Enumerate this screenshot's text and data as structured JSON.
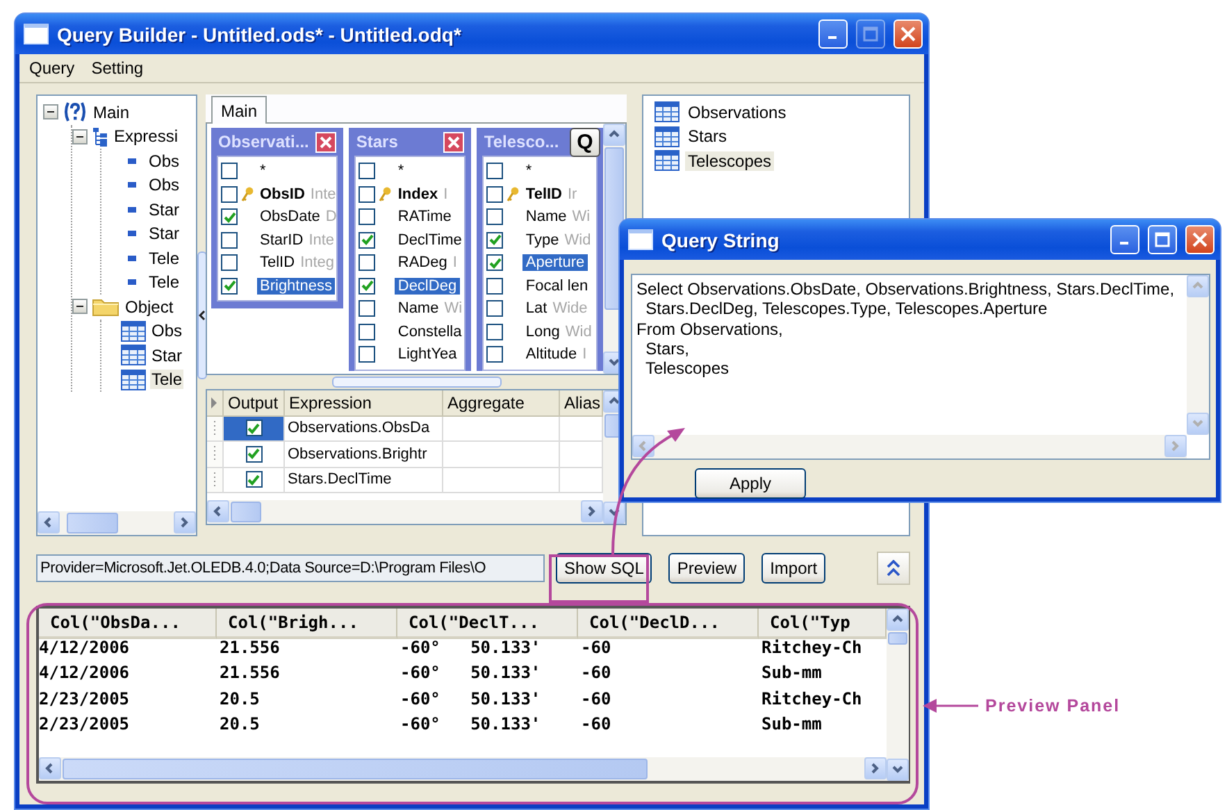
{
  "window": {
    "title": "Query Builder - Untitled.ods* - Untitled.odq*",
    "controls": [
      {
        "kind": "minimize",
        "disabled": false
      },
      {
        "kind": "maximize",
        "disabled": true
      },
      {
        "kind": "close",
        "disabled": false
      }
    ]
  },
  "menu": [
    "Query",
    "Setting"
  ],
  "object_tree": {
    "items": [
      {
        "label": "Main",
        "kind": "query",
        "expanded": true,
        "selected": false,
        "children": [
          {
            "label": "Expressi",
            "kind": "expressions",
            "expanded": true,
            "selected": false,
            "children": [
              {
                "label": "Obs",
                "kind": "field",
                "selected": false
              },
              {
                "label": "Obs",
                "kind": "field",
                "selected": false
              },
              {
                "label": "Star",
                "kind": "field",
                "selected": false
              },
              {
                "label": "Star",
                "kind": "field",
                "selected": false
              },
              {
                "label": "Tele",
                "kind": "field",
                "selected": false
              },
              {
                "label": "Tele",
                "kind": "field",
                "selected": false
              }
            ]
          },
          {
            "label": "Object",
            "kind": "folder",
            "expanded": true,
            "selected": false,
            "children": [
              {
                "label": "Obs",
                "kind": "table",
                "selected": false
              },
              {
                "label": "Star",
                "kind": "table",
                "selected": false
              },
              {
                "label": "Tele",
                "kind": "table",
                "selected": true
              }
            ]
          }
        ]
      }
    ]
  },
  "designer": {
    "tabs": [
      {
        "label": "Main",
        "selected": true
      }
    ],
    "query_button": "Q",
    "tables": [
      {
        "title": "Observati...",
        "fields": [
          {
            "name": "*",
            "key": false,
            "checked": false,
            "selected": false
          },
          {
            "name": "ObsID",
            "type": "Inte",
            "key": true,
            "checked": false,
            "selected": false
          },
          {
            "name": "ObsDate",
            "type": "D",
            "key": false,
            "checked": true,
            "selected": false
          },
          {
            "name": "StarID",
            "type": "Inte",
            "key": false,
            "checked": false,
            "selected": false
          },
          {
            "name": "TelID",
            "type": "Integ",
            "key": false,
            "checked": false,
            "selected": false
          },
          {
            "name": "Brightness",
            "key": false,
            "checked": true,
            "selected": true
          }
        ]
      },
      {
        "title": "Stars",
        "fields": [
          {
            "name": "*",
            "key": false,
            "checked": false,
            "selected": false
          },
          {
            "name": "Index",
            "type": "I",
            "key": true,
            "checked": false,
            "selected": false
          },
          {
            "name": "RATime",
            "key": false,
            "checked": false,
            "selected": false
          },
          {
            "name": "DeclTime",
            "key": false,
            "checked": true,
            "selected": false
          },
          {
            "name": "RADeg",
            "type": "I",
            "key": false,
            "checked": false,
            "selected": false
          },
          {
            "name": "DeclDeg",
            "key": false,
            "checked": true,
            "selected": true
          },
          {
            "name": "Name",
            "type": "Wi",
            "key": false,
            "checked": false,
            "selected": false
          },
          {
            "name": "Constella",
            "key": false,
            "checked": false,
            "selected": false
          },
          {
            "name": "LightYea",
            "key": false,
            "checked": false,
            "selected": false
          }
        ]
      },
      {
        "title": "Telesco...",
        "fields": [
          {
            "name": "*",
            "key": false,
            "checked": false,
            "selected": false
          },
          {
            "name": "TelID",
            "type": "Ir",
            "key": true,
            "checked": false,
            "selected": false
          },
          {
            "name": "Name",
            "type": "Wi",
            "key": false,
            "checked": false,
            "selected": false
          },
          {
            "name": "Type",
            "type": "Wid",
            "key": false,
            "checked": true,
            "selected": false
          },
          {
            "name": "Aperture",
            "key": false,
            "checked": true,
            "selected": true
          },
          {
            "name": "Focal len",
            "key": false,
            "checked": false,
            "selected": false
          },
          {
            "name": "Lat",
            "type": "Wide",
            "key": false,
            "checked": false,
            "selected": false
          },
          {
            "name": "Long",
            "type": "Wid",
            "key": false,
            "checked": false,
            "selected": false
          },
          {
            "name": "Altitude",
            "type": "I",
            "key": false,
            "checked": false,
            "selected": false
          }
        ]
      }
    ],
    "grid": {
      "columns": [
        "Output",
        "Expression",
        "Aggregate",
        "Alias"
      ],
      "rows": [
        {
          "output": true,
          "expression": "Observations.ObsDa",
          "selected": true
        },
        {
          "output": true,
          "expression": "Observations.Brightr",
          "selected": false
        },
        {
          "output": true,
          "expression": "Stars.DeclTime",
          "selected": false
        }
      ]
    }
  },
  "table_list": {
    "items": [
      {
        "label": "Observations",
        "selected": false
      },
      {
        "label": "Stars",
        "selected": false
      },
      {
        "label": "Telescopes",
        "selected": true
      }
    ]
  },
  "connection_string": "Provider=Microsoft.Jet.OLEDB.4.0;Data Source=D:\\Program Files\\O",
  "buttons": [
    "Show SQL",
    "Preview",
    "Import"
  ],
  "preview": {
    "columns": [
      "Col(\"ObsDa...",
      "Col(\"Brigh...",
      "Col(\"DeclT...",
      "Col(\"DeclD...",
      "Col(\"Typ"
    ],
    "rows": [
      [
        "4/12/2006",
        "21.556",
        "-60°   50.133'",
        "-60",
        "Ritchey-Ch"
      ],
      [
        "4/12/2006",
        "21.556",
        "-60°   50.133'",
        "-60",
        "Sub-mm"
      ],
      [
        "2/23/2005",
        "20.5",
        "-60°   50.133'",
        "-60",
        "Ritchey-Ch"
      ],
      [
        "2/23/2005",
        "20.5",
        "-60°   50.133'",
        "-60",
        "Sub-mm"
      ]
    ]
  },
  "query_dialog": {
    "title": "Query String",
    "text": "Select Observations.ObsDate, Observations.Brightness, Stars.DeclTime,\n  Stars.DeclDeg, Telescopes.Type, Telescopes.Aperture\nFrom Observations,\n  Stars,\n  Telescopes",
    "button": "Apply",
    "controls": [
      {
        "kind": "minimize",
        "disabled": false
      },
      {
        "kind": "maximize",
        "disabled": false
      },
      {
        "kind": "close",
        "disabled": false
      }
    ]
  },
  "annotation": {
    "label": "Preview Panel"
  }
}
